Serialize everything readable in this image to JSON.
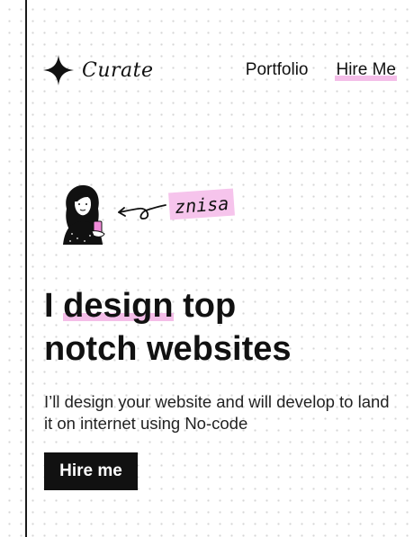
{
  "brand": {
    "logo_icon": "sparkle-icon",
    "name": "Curate"
  },
  "nav": {
    "items": [
      {
        "label": "Portfolio"
      },
      {
        "label": "Hire Me",
        "highlighted": true
      }
    ]
  },
  "hero": {
    "avatar_icon": "illustrated-avatar",
    "arrow_icon": "curly-arrow-icon",
    "name_tag": "znisa",
    "headline": {
      "highlight": "design",
      "line1_before": "I ",
      "line1_after": " top",
      "line2": "notch websites"
    },
    "description": "I’ll design your website and will develop to land it on internet using No-code",
    "cta_label": "Hire me"
  },
  "colors": {
    "accent_pink": "#f4bde8",
    "text": "#111111",
    "cta_bg": "#111111",
    "cta_text": "#ffffff",
    "dot_grid": "#d6d6d6"
  }
}
